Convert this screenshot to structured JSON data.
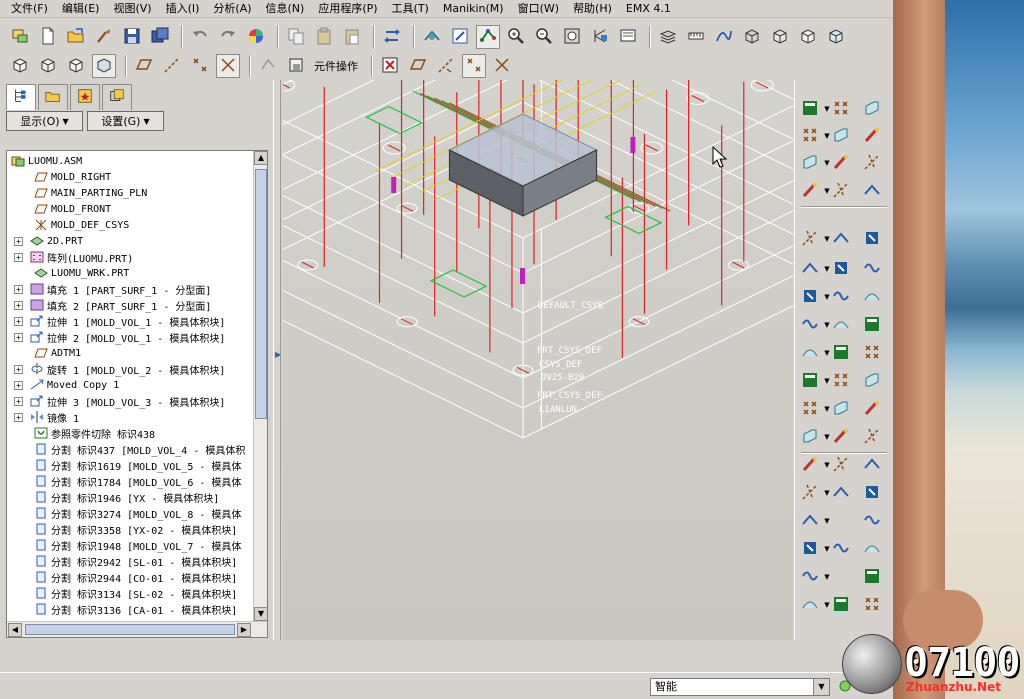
{
  "menu": [
    "文件(F)",
    "编辑(E)",
    "视图(V)",
    "插入(I)",
    "分析(A)",
    "信息(N)",
    "应用程序(P)",
    "工具(T)",
    "Manikin(M)",
    "窗口(W)",
    "帮助(H)",
    "EMX 4.1"
  ],
  "toolbar1": {
    "icons": [
      "open-assembly-icon",
      "new-file-icon",
      "open-folder-icon",
      "brush-icon",
      "save-icon",
      "save-copy-icon",
      "undo-icon",
      "redo-icon",
      "color-wheel-icon",
      "copy-icon",
      "paste-icon",
      "paste-special-icon",
      "regenerate-icon",
      "orient-icon",
      "repaint-icon",
      "spin-center-icon",
      "zoom-in-icon",
      "zoom-out-icon",
      "refit-icon",
      "saved-view-icon",
      "named-view-icon",
      "layers-icon",
      "measure-icon",
      "datum-curve-icon",
      "wireframe-icon",
      "hidden-line-icon",
      "no-hidden-icon",
      "shaded-icon"
    ]
  },
  "toolbar2": {
    "icons_left": [
      "cube-1-icon",
      "cube-2-icon",
      "cube-3-icon",
      "cube-4-icon",
      "datum-plane-icon",
      "datum-axis-icon",
      "datum-point-icon",
      "csys-icon",
      "spin-off-icon",
      "part-box-icon"
    ],
    "component_ops_label": "元件操作",
    "icons_right": [
      "close-x-icon",
      "plane-display-icon",
      "axis-display-icon",
      "point-display-icon",
      "csys-display-icon"
    ]
  },
  "panel": {
    "tabs": [
      "model-tree-tab-icon",
      "folder-tab-icon",
      "favorites-tab-icon",
      "layers-tab-icon"
    ],
    "show_label": "显示(O)",
    "settings_label": "设置(G)"
  },
  "tree": [
    {
      "text": "LUOMU.ASM",
      "indent": 0,
      "exp": false,
      "icon": "assembly"
    },
    {
      "text": "MOLD_RIGHT",
      "indent": 1,
      "exp": false,
      "icon": "plane"
    },
    {
      "text": "MAIN_PARTING_PLN",
      "indent": 1,
      "exp": false,
      "icon": "plane"
    },
    {
      "text": "MOLD_FRONT",
      "indent": 1,
      "exp": false,
      "icon": "plane"
    },
    {
      "text": "MOLD_DEF_CSYS",
      "indent": 1,
      "exp": false,
      "icon": "csys"
    },
    {
      "text": "2D.PRT",
      "indent": 1,
      "exp": true,
      "icon": "part"
    },
    {
      "text": "阵列(LUOMU.PRT)",
      "indent": 1,
      "exp": true,
      "icon": "pattern"
    },
    {
      "text": "LUOMU_WRK.PRT",
      "indent": 1,
      "exp": false,
      "icon": "part"
    },
    {
      "text": "填充 1 [PART_SURF_1 - 分型面]",
      "indent": 1,
      "exp": true,
      "icon": "fill"
    },
    {
      "text": "填充 2 [PART_SURF_1 - 分型面]",
      "indent": 1,
      "exp": true,
      "icon": "fill"
    },
    {
      "text": "拉伸 1 [MOLD_VOL_1 - 模具体积块]",
      "indent": 1,
      "exp": true,
      "icon": "extrude"
    },
    {
      "text": "拉伸 2 [MOLD_VOL_1 - 模具体积块]",
      "indent": 1,
      "exp": true,
      "icon": "extrude"
    },
    {
      "text": "ADTM1",
      "indent": 1,
      "exp": false,
      "icon": "plane"
    },
    {
      "text": "旋转 1 [MOLD_VOL_2 - 模具体积块]",
      "indent": 1,
      "exp": true,
      "icon": "revolve"
    },
    {
      "text": "Moved Copy 1",
      "indent": 1,
      "exp": true,
      "icon": "copy"
    },
    {
      "text": "拉伸 3 [MOLD_VOL_3 - 模具体积块]",
      "indent": 1,
      "exp": true,
      "icon": "extrude"
    },
    {
      "text": "镜像 1",
      "indent": 1,
      "exp": true,
      "icon": "mirror"
    },
    {
      "text": "参照零件切除 标识438",
      "indent": 1,
      "exp": false,
      "icon": "cut"
    },
    {
      "text": "分割 标识437 [MOLD_VOL_4 - 模具体积",
      "indent": 1,
      "exp": false,
      "icon": "split"
    },
    {
      "text": "分割 标识1619 [MOLD_VOL_5 - 模具体",
      "indent": 1,
      "exp": false,
      "icon": "split"
    },
    {
      "text": "分割 标识1784 [MOLD_VOL_6 - 模具体",
      "indent": 1,
      "exp": false,
      "icon": "split"
    },
    {
      "text": "分割 标识1946 [YX - 模具体积块]",
      "indent": 1,
      "exp": false,
      "icon": "split"
    },
    {
      "text": "分割 标识3274 [MOLD_VOL_8 - 模具体",
      "indent": 1,
      "exp": false,
      "icon": "split"
    },
    {
      "text": "分割 标识3358 [YX-02 - 模具体积块]",
      "indent": 1,
      "exp": false,
      "icon": "split"
    },
    {
      "text": "分割 标识1948 [MOLD_VOL_7 - 模具体",
      "indent": 1,
      "exp": false,
      "icon": "split"
    },
    {
      "text": "分割 标识2942 [SL-01 - 模具体积块]",
      "indent": 1,
      "exp": false,
      "icon": "split"
    },
    {
      "text": "分割 标识2944 [CO-01 - 模具体积块]",
      "indent": 1,
      "exp": false,
      "icon": "split"
    },
    {
      "text": "分割 标识3134 [SL-02 - 模具体积块]",
      "indent": 1,
      "exp": false,
      "icon": "split"
    },
    {
      "text": "分割 标识3136 [CA-01 - 模具体积块]",
      "indent": 1,
      "exp": false,
      "icon": "split"
    }
  ],
  "viewport_labels": [
    "DEFAULT_CSYS",
    "PRT_CSYS_DEF",
    "CSYS_DEF",
    "DV25-B20",
    "PRT_CSYS_DEF",
    "LIANLUN"
  ],
  "status": {
    "filter_value": "智能"
  },
  "watermark": {
    "digits": "07100",
    "site": "Zhuanzhu.Net"
  },
  "colors": {
    "wire_white": "#ffffff",
    "wire_red": "#e02020",
    "wire_green": "#20c040",
    "wire_yellow": "#e8d020",
    "wire_magenta": "#c020c0"
  }
}
